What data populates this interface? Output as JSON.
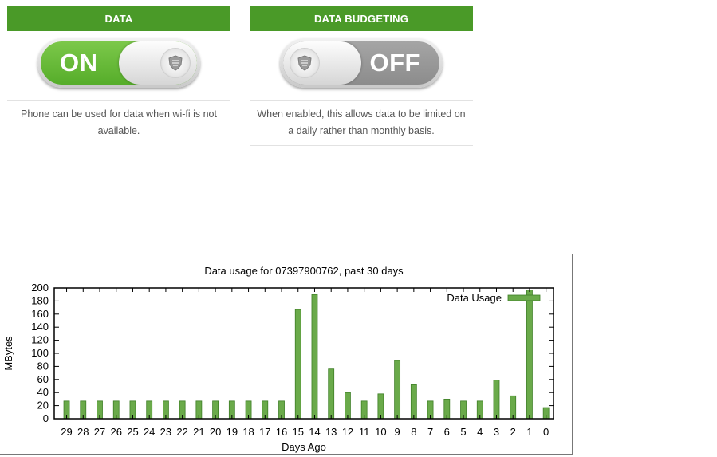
{
  "data_panel": {
    "header": "DATA",
    "toggle_state": "ON",
    "toggle_icon": "shield-badge-icon",
    "description": "Phone can be used for data when wi-fi is not available."
  },
  "budget_panel": {
    "header": "DATA BUDGETING",
    "toggle_state": "OFF",
    "toggle_icon": "shield-badge-icon",
    "description": "When enabled, this allows data to be limited on a daily rather than monthly basis."
  },
  "colors": {
    "header_green": "#4a9a28",
    "toggle_on_green": "#6abd3a",
    "toggle_off_gray": "#999999",
    "bar_green": "#6aaa4a"
  },
  "chart_data": {
    "type": "bar",
    "title": "Data usage for 07397900762, past 30 days",
    "xlabel": "Days Ago",
    "ylabel": "MBytes",
    "ylim": [
      0,
      200
    ],
    "yticks": [
      0,
      20,
      40,
      60,
      80,
      100,
      120,
      140,
      160,
      180,
      200
    ],
    "grid": false,
    "legend_position": "top-right",
    "categories": [
      "29",
      "28",
      "27",
      "26",
      "25",
      "24",
      "23",
      "22",
      "21",
      "20",
      "19",
      "18",
      "17",
      "16",
      "15",
      "14",
      "13",
      "12",
      "11",
      "10",
      "9",
      "8",
      "7",
      "6",
      "5",
      "4",
      "3",
      "2",
      "1",
      "0"
    ],
    "series": [
      {
        "name": "Data Usage",
        "values": [
          27,
          27,
          27,
          27,
          27,
          27,
          27,
          27,
          27,
          27,
          27,
          27,
          27,
          27,
          167,
          190,
          76,
          40,
          27,
          38,
          89,
          52,
          27,
          30,
          27,
          27,
          59,
          35,
          197,
          17
        ]
      }
    ]
  }
}
